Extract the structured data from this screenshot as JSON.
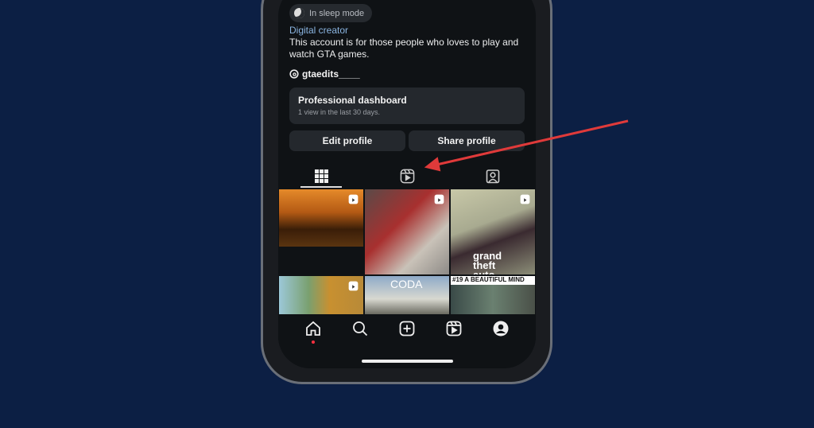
{
  "profile": {
    "sleep_badge": "In sleep mode",
    "category": "Digital creator",
    "bio": "This account is for those people who loves to play and watch GTA games.",
    "threads_handle": "gtaedits____"
  },
  "dashboard": {
    "title": "Professional dashboard",
    "subtitle": "1 view in the last 30 days."
  },
  "buttons": {
    "edit": "Edit profile",
    "share": "Share profile"
  },
  "tabs": [
    {
      "icon": "grid-icon",
      "active": true
    },
    {
      "icon": "reels-icon",
      "active": false
    },
    {
      "icon": "tagged-icon",
      "active": false
    }
  ],
  "grid": {
    "tiles": [
      {
        "overlay": ""
      },
      {
        "overlay": ""
      },
      {
        "overlay": "grand theft auto"
      },
      {
        "overlay": ""
      },
      {
        "overlay": "CODA"
      },
      {
        "overlay": "#19  A BEAUTIFUL MIND"
      }
    ]
  },
  "nav": [
    "home-icon",
    "search-icon",
    "create-icon",
    "reels-icon",
    "profile-icon"
  ],
  "colors": {
    "background": "#0c1f44",
    "arrow": "#e03a3a",
    "notification_dot": "#ff3040"
  }
}
